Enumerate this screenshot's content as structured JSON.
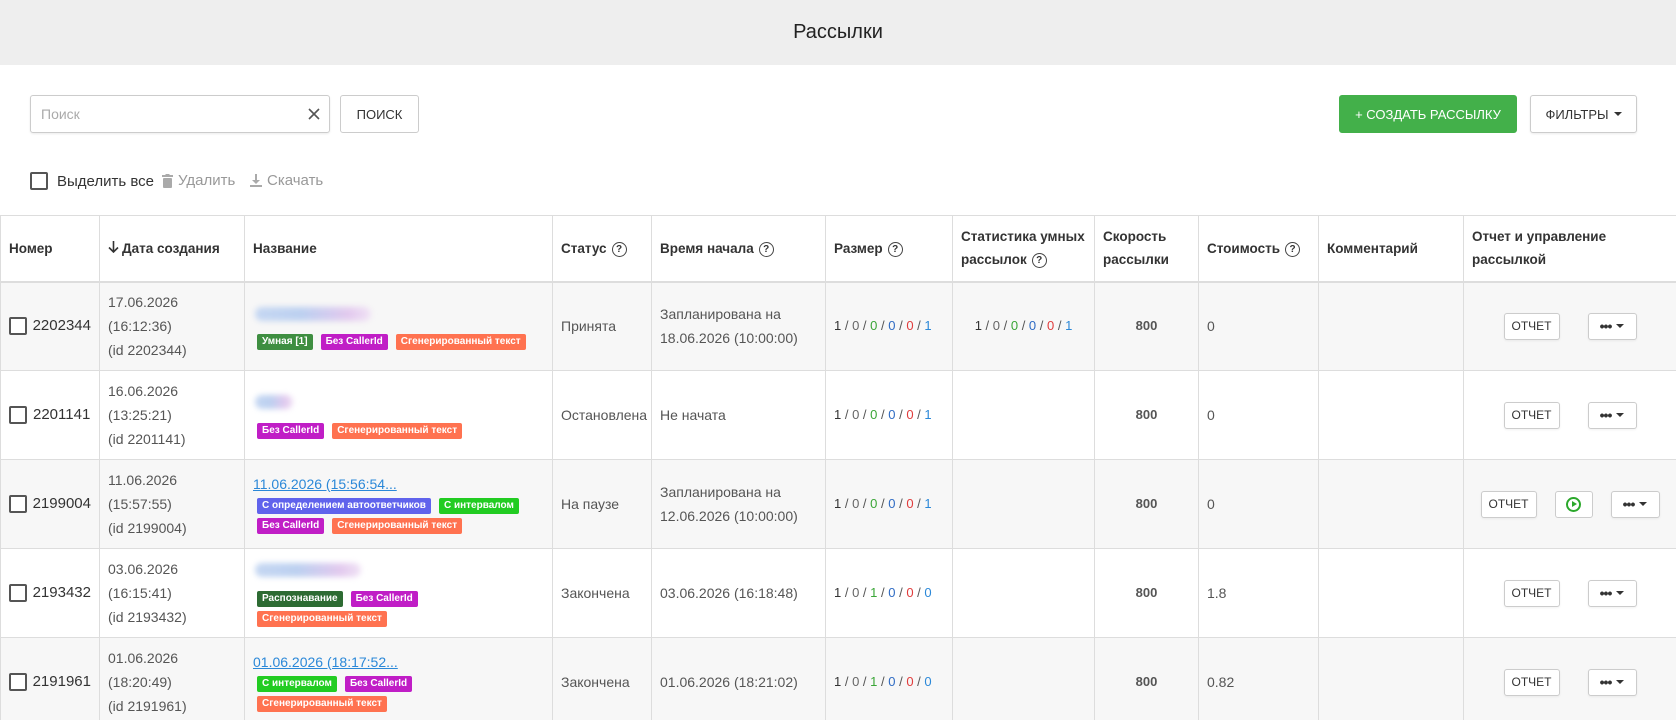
{
  "header": {
    "title": "Рассылки"
  },
  "toolbar": {
    "search_placeholder": "Поиск",
    "search_value": "",
    "search_button": "ПОИСК",
    "create_button": "+ СОЗДАТЬ РАССЫЛКУ",
    "filters_button": "ФИЛЬТРЫ"
  },
  "actions": {
    "select_all": "Выделить все",
    "delete": "Удалить",
    "download": "Скачать"
  },
  "table": {
    "columns": {
      "number": "Номер",
      "created": "Дата создания",
      "name": "Название",
      "status": "Статус",
      "start_time": "Время начала",
      "size": "Размер",
      "smart_stats": "Статистика умных рассылок",
      "speed": "Скорость рассылки",
      "cost": "Стоимость",
      "comment": "Комментарий",
      "control": "Отчет и управление рассылкой"
    },
    "report_label": "ОТЧЕТ",
    "more_label": "•••",
    "rows": [
      {
        "number": "2202344",
        "date": "17.06.2026",
        "time": "(16:12:36)",
        "id": "(id 2202344)",
        "name_link": "",
        "tags": [
          "Умная [1]",
          "Без CallerId",
          "Сгенерированный текст"
        ],
        "status": "Принята",
        "start_line1": "Запланирована на",
        "start_line2": "18.06.2026 (10:00:00)",
        "size": [
          "1",
          "0",
          "0",
          "0",
          "0",
          "1"
        ],
        "smart": [
          "1",
          "0",
          "0",
          "0",
          "0",
          "1"
        ],
        "speed": "800",
        "cost": "0",
        "comment": ""
      },
      {
        "number": "2201141",
        "date": "16.06.2026",
        "time": "(13:25:21)",
        "id": "(id 2201141)",
        "name_link": "",
        "tags": [
          "Без CallerId",
          "Сгенерированный текст"
        ],
        "status": "Остановлена",
        "start_line1": "Не начата",
        "start_line2": "",
        "size": [
          "1",
          "0",
          "0",
          "0",
          "0",
          "1"
        ],
        "smart": [],
        "speed": "800",
        "cost": "0",
        "comment": ""
      },
      {
        "number": "2199004",
        "date": "11.06.2026",
        "time": "(15:57:55)",
        "id": "(id 2199004)",
        "name_link": "11.06.2026 (15:56:54...",
        "tags": [
          "С определением автоответчиков",
          "С интервалом",
          "Без CallerId",
          "Сгенерированный текст"
        ],
        "status": "На паузе",
        "start_line1": "Запланирована на",
        "start_line2": "12.06.2026 (10:00:00)",
        "size": [
          "1",
          "0",
          "0",
          "0",
          "0",
          "1"
        ],
        "smart": [],
        "speed": "800",
        "cost": "0",
        "comment": ""
      },
      {
        "number": "2193432",
        "date": "03.06.2026",
        "time": "(16:15:41)",
        "id": "(id 2193432)",
        "name_link": "",
        "tags": [
          "Распознавание",
          "Без CallerId",
          "Сгенерированный текст"
        ],
        "status": "Закончена",
        "start_line1": "03.06.2026 (16:18:48)",
        "start_line2": "",
        "size": [
          "1",
          "0",
          "1",
          "0",
          "0",
          "0"
        ],
        "smart": [],
        "speed": "800",
        "cost": "1.8",
        "comment": ""
      },
      {
        "number": "2191961",
        "date": "01.06.2026",
        "time": "(18:20:49)",
        "id": "(id 2191961)",
        "name_link": "01.06.2026 (18:17:52...",
        "tags": [
          "С интервалом",
          "Без CallerId",
          "Сгенерированный текст"
        ],
        "status": "Закончена",
        "start_line1": "01.06.2026 (18:21:02)",
        "start_line2": "",
        "size": [
          "1",
          "0",
          "1",
          "0",
          "0",
          "0"
        ],
        "smart": [],
        "speed": "800",
        "cost": "0.82",
        "comment": ""
      }
    ]
  },
  "colors": {
    "accent_green": "#43b04a",
    "link_blue": "#2b88d8",
    "header_bg": "#eeeeee"
  }
}
